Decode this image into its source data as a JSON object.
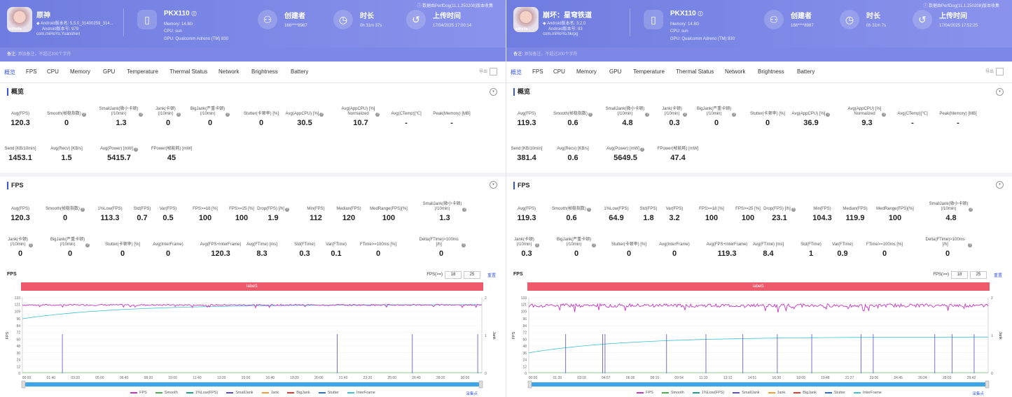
{
  "panels": [
    {
      "topnote": "ⓘ 数据由PerfDog(11.1.250208)版本收集",
      "app": {
        "name": "原神",
        "icon_text": "miHoYo",
        "version": "Android版本名: 5.5.0_31400259_314...",
        "code": "Android版本号: 979",
        "package": "com.miHoYo.Yuanshen"
      },
      "device": {
        "name": "PKX110",
        "memory": "Memory: 14.8G",
        "cpu": "CPU: sun",
        "gpu": "GPU: Qualcomm Adreno (TM) 830"
      },
      "creator": {
        "title": "创建者",
        "value": "166****8987"
      },
      "duration": {
        "title": "时长",
        "value": "0h 31m 37s"
      },
      "upload": {
        "title": "上传时间",
        "value": "17/04/2025 17:00:14"
      },
      "remark": {
        "label": "备注:",
        "placeholder": "添加备注，不超过200个字符"
      },
      "tabs": [
        "概览",
        "FPS",
        "CPU",
        "Memory",
        "GPU",
        "Temperature",
        "Thermal Status",
        "Network",
        "Brightness",
        "Battery"
      ],
      "export_label": "导出",
      "overview_title": "概览",
      "overview_row1": [
        {
          "label": "Avg(FPS)",
          "value": "120.3"
        },
        {
          "label": "Smooth(帧稳指数)",
          "value": "0",
          "q": true
        },
        {
          "label": "SmallJank(微小卡顿)\n(/10min)",
          "value": "1.3",
          "q": true
        },
        {
          "label": "Jank(卡顿)\n(/10min)",
          "value": "0",
          "q": true
        },
        {
          "label": "BigJank(严重卡顿)\n(/10min)",
          "value": "0",
          "q": true
        },
        {
          "label": "Stutter(卡顿率) [%]",
          "value": "0"
        },
        {
          "label": "Avg(AppCPU) [%]",
          "value": "30.5",
          "q": true
        },
        {
          "label": "Avg(AppCPU) [%]\nNormalized",
          "value": "10.7",
          "q": true
        },
        {
          "label": "Avg(CTemp)[℃]",
          "value": "-"
        },
        {
          "label": "Peak(Memory) [MB]",
          "value": "-"
        }
      ],
      "overview_row2": [
        {
          "label": "Send [KB/10min]",
          "value": "1453.1"
        },
        {
          "label": "Avg(Recv) [KB/s]",
          "value": "1.5"
        },
        {
          "label": "Avg(Power) [mW]",
          "value": "5415.7",
          "q": true
        },
        {
          "label": "FPower(帧能耗) [mW]",
          "value": "45"
        }
      ],
      "fps_title": "FPS",
      "fps_row1": [
        {
          "label": "Avg(FPS)",
          "value": "120.3"
        },
        {
          "label": "Smooth(帧稳指数)",
          "value": "0",
          "q": true
        },
        {
          "label": "1%Low(FPS)",
          "value": "113.3"
        },
        {
          "label": "Std(FPS)",
          "value": "0.7"
        },
        {
          "label": "Var(FPS)",
          "value": "0.5"
        },
        {
          "label": "FPS>=18 [%]",
          "value": "100"
        },
        {
          "label": "FPS>=25 [%]",
          "value": "100"
        },
        {
          "label": "Drop(FPS) [/h]",
          "value": "1.9",
          "q": true
        },
        {
          "label": "Min(FPS)",
          "value": "112"
        },
        {
          "label": "Median(FPS)",
          "value": "120"
        },
        {
          "label": "MedRange(FPS)[%]",
          "value": "100"
        },
        {
          "label": "SmallJank(微小卡顿)\n(/10min)",
          "value": "1.3",
          "q": true
        }
      ],
      "fps_row2": [
        {
          "label": "Jank(卡顿)\n(/10min)",
          "value": "0",
          "q": true
        },
        {
          "label": "BigJank(严重卡顿)\n(/10min)",
          "value": "0",
          "q": true
        },
        {
          "label": "Stutter(卡顿率) [%]",
          "value": "0"
        },
        {
          "label": "Avg(InterFrame)",
          "value": "0"
        },
        {
          "label": "Avg(FPS+InterFrame)",
          "value": "120.3"
        },
        {
          "label": "Avg(FTime) [ms]",
          "value": "8.3"
        },
        {
          "label": "Std(FTime)",
          "value": "0.3"
        },
        {
          "label": "Var(FTime)",
          "value": "0.1"
        },
        {
          "label": "FTime>=100ms [%]",
          "value": "0"
        },
        {
          "label": "Delta(FTime)>100ms [/h]",
          "value": "0",
          "q": true
        }
      ],
      "chart_label": "FPS",
      "threshold_label": "FPS(>=)",
      "threshold_values": [
        "18",
        "25"
      ],
      "reset_label": "重置",
      "band_label": "label1",
      "legend_right": "采集点",
      "chart_data": {
        "type": "line",
        "title": "FPS",
        "ylabel": "FPS",
        "y2label": "Jank",
        "ylim": [
          0,
          133
        ],
        "y_ticks": [
          "0",
          "12",
          "24",
          "36",
          "48",
          "60",
          "72",
          "84",
          "96",
          "109",
          "121",
          "133"
        ],
        "y2_ticks": [
          "0",
          "1",
          "2"
        ],
        "x_ticks": [
          "00:00",
          "01:40",
          "03:20",
          "05:00",
          "06:40",
          "08:20",
          "10:00",
          "11:40",
          "13:20",
          "15:00",
          "16:40",
          "18:20",
          "20:00",
          "21:40",
          "23:20",
          "25:00",
          "26:40",
          "28:20",
          "30:00"
        ],
        "x_max_s": 1897,
        "fps_level": 120.3,
        "interframe_start": 96,
        "interframe_end": 121,
        "smalljank_times_s": [
          165,
          1300,
          1610,
          1880
        ],
        "legend": [
          "FPS",
          "Smooth",
          "1%Low(FPS)",
          "SmallJank",
          "Jank",
          "BigJank",
          "Stutter",
          "InterFrame"
        ],
        "colors": {
          "FPS": "#c537c0",
          "Smooth": "#4caf50",
          "1%Low(FPS)": "#1f9f8f",
          "SmallJank": "#5a4fc6",
          "Jank": "#f39c34",
          "BigJank": "#e53935",
          "Stutter": "#2c6fd1",
          "InterFrame": "#3ec1cc"
        }
      }
    },
    {
      "topnote": "ⓘ 数据由PerfDog(11.1.250208)版本收集",
      "app": {
        "name": "崩坏：星穹铁道",
        "icon_text": "miHoYo",
        "version": "Android版本名: 3.2.0",
        "code": "Android版本号: 83",
        "package": "com.miHoYo.hkrpg"
      },
      "device": {
        "name": "PKX110",
        "memory": "Memory: 14.8G",
        "cpu": "CPU: sun",
        "gpu": "GPU: Qualcomm Adreno (TM) 830"
      },
      "creator": {
        "title": "创建者",
        "value": "166****8987"
      },
      "duration": {
        "title": "时长",
        "value": "0h 31m 7s"
      },
      "upload": {
        "title": "上传时间",
        "value": "17/04/2025 17:52:25"
      },
      "remark": {
        "label": "备注:",
        "placeholder": "添加备注，不超过200个字符"
      },
      "tabs": [
        "概览",
        "FPS",
        "CPU",
        "Memory",
        "GPU",
        "Temperature",
        "Thermal Status",
        "Network",
        "Brightness",
        "Battery"
      ],
      "export_label": "导出",
      "overview_title": "概览",
      "overview_row1": [
        {
          "label": "Avg(FPS)",
          "value": "119.3"
        },
        {
          "label": "Smooth(帧稳指数)",
          "value": "0.6",
          "q": true
        },
        {
          "label": "SmallJank(微小卡顿)\n(/10min)",
          "value": "4.8",
          "q": true
        },
        {
          "label": "Jank(卡顿)\n(/10min)",
          "value": "0.3",
          "q": true
        },
        {
          "label": "BigJank(严重卡顿)\n(/10min)",
          "value": "0",
          "q": true
        },
        {
          "label": "Stutter(卡顿率) [%]",
          "value": "0"
        },
        {
          "label": "Avg(AppCPU) [%]",
          "value": "36.9",
          "q": true
        },
        {
          "label": "Avg(AppCPU) [%]\nNormalized",
          "value": "9.3",
          "q": true
        },
        {
          "label": "Avg(CTemp)[℃]",
          "value": "-"
        },
        {
          "label": "Peak(Memory) [MB]",
          "value": "-"
        }
      ],
      "overview_row2": [
        {
          "label": "Send [KB/10min]",
          "value": "381.4"
        },
        {
          "label": "Avg(Recv) [KB/s]",
          "value": "0.6"
        },
        {
          "label": "Avg(Power) [mW]",
          "value": "5649.5",
          "q": true
        },
        {
          "label": "FPower(帧能耗) [mW]",
          "value": "47.4"
        }
      ],
      "fps_title": "FPS",
      "fps_row1": [
        {
          "label": "Avg(FPS)",
          "value": "119.3"
        },
        {
          "label": "Smooth(帧稳指数)",
          "value": "0.6",
          "q": true
        },
        {
          "label": "1%Low(FPS)",
          "value": "64.9"
        },
        {
          "label": "Std(FPS)",
          "value": "1.8"
        },
        {
          "label": "Var(FPS)",
          "value": "3.2"
        },
        {
          "label": "FPS>=18 [%]",
          "value": "100"
        },
        {
          "label": "FPS>=25 [%]",
          "value": "100"
        },
        {
          "label": "Drop(FPS) [/h]",
          "value": "23.1",
          "q": true
        },
        {
          "label": "Min(FPS)",
          "value": "104.3"
        },
        {
          "label": "Median(FPS)",
          "value": "119.9"
        },
        {
          "label": "MedRange(FPS)[%]",
          "value": "100"
        },
        {
          "label": "SmallJank(微小卡顿)\n(/10min)",
          "value": "4.8",
          "q": true
        }
      ],
      "fps_row2": [
        {
          "label": "Jank(卡顿)\n(/10min)",
          "value": "0.3",
          "q": true
        },
        {
          "label": "BigJank(严重卡顿)\n(/10min)",
          "value": "0",
          "q": true
        },
        {
          "label": "Stutter(卡顿率) [%]",
          "value": "0"
        },
        {
          "label": "Avg(InterFrame)",
          "value": "0"
        },
        {
          "label": "Avg(FPS+InterFrame)",
          "value": "119.3"
        },
        {
          "label": "Avg(FTime) [ms]",
          "value": "8.4"
        },
        {
          "label": "Std(FTime)",
          "value": "1"
        },
        {
          "label": "Var(FTime)",
          "value": "0.9"
        },
        {
          "label": "FTime>=100ms [%]",
          "value": "0"
        },
        {
          "label": "Delta(FTime)>100ms [/h]",
          "value": "0",
          "q": true
        }
      ],
      "chart_label": "FPS",
      "threshold_label": "FPS(>=)",
      "threshold_values": [
        "18",
        "25"
      ],
      "reset_label": "重置",
      "band_label": "label1",
      "legend_right": "采集点",
      "chart_data": {
        "type": "line",
        "title": "FPS",
        "ylabel": "FPS",
        "y2label": "Jank",
        "ylim": [
          0,
          133
        ],
        "y_ticks": [
          "0",
          "12",
          "24",
          "36",
          "48",
          "60",
          "72",
          "84",
          "96",
          "109",
          "121",
          "133"
        ],
        "y2_ticks": [
          "0",
          "1",
          "2"
        ],
        "x_ticks": [
          "00:00",
          "01:39",
          "03:18",
          "04:57",
          "06:36",
          "08:15",
          "09:54",
          "11:33",
          "13:12",
          "14:51",
          "16:30",
          "18:09",
          "19:48",
          "21:27",
          "23:06",
          "24:45",
          "26:24",
          "28:03",
          "29:42"
        ],
        "x_max_s": 1867,
        "fps_level": 119.3,
        "interframe_start": 36,
        "interframe_end": 64,
        "smalljank_times_s": [
          150,
          300,
          310,
          560,
          720,
          870,
          1010,
          1150,
          1350,
          1400,
          1650,
          1720,
          1810
        ],
        "legend": [
          "FPS",
          "Smooth",
          "1%Low(FPS)",
          "SmallJank",
          "Jank",
          "BigJank",
          "Stutter",
          "InterFrame"
        ],
        "colors": {
          "FPS": "#c537c0",
          "Smooth": "#4caf50",
          "1%Low(FPS)": "#1f9f8f",
          "SmallJank": "#5a4fc6",
          "Jank": "#f39c34",
          "BigJank": "#e53935",
          "Stutter": "#2c6fd1",
          "InterFrame": "#3ec1cc"
        }
      }
    }
  ]
}
